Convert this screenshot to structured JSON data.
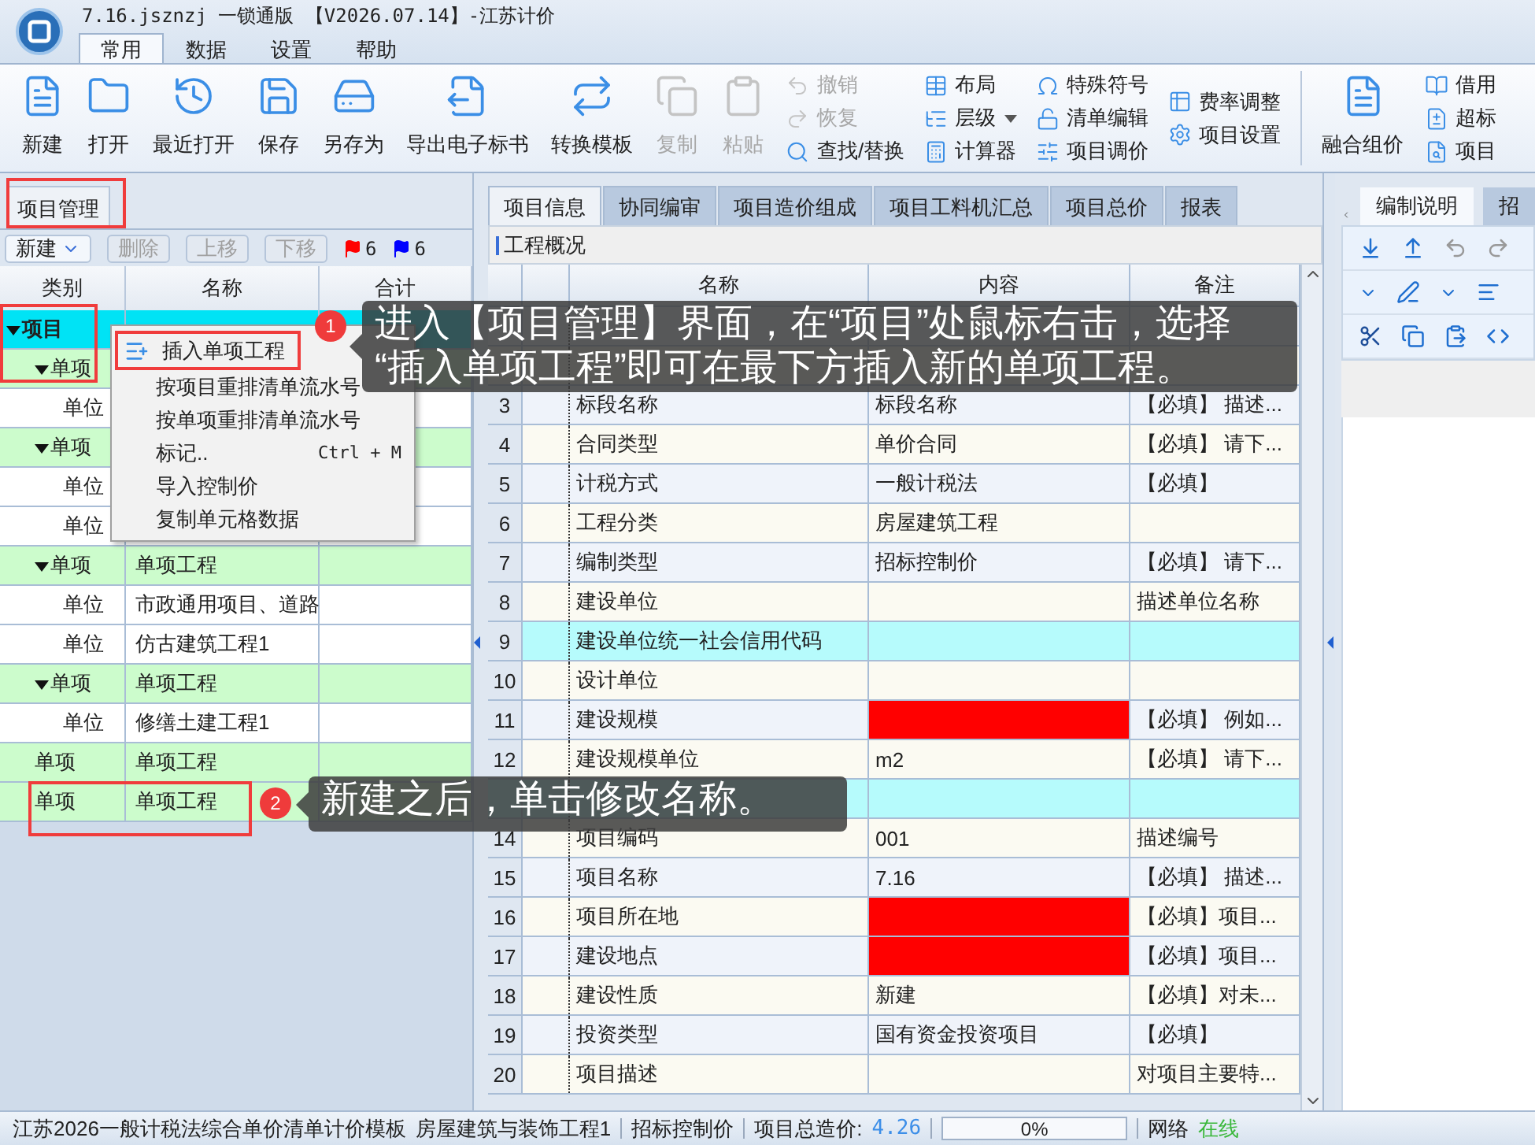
{
  "app": {
    "title": "7.16.jsznzj 一锁通版 【V2026.07.14】-江苏计价"
  },
  "menu_tabs": [
    {
      "label": "常用",
      "selected": true
    },
    {
      "label": "数据",
      "selected": false
    },
    {
      "label": "设置",
      "selected": false
    },
    {
      "label": "帮助",
      "selected": false
    }
  ],
  "ribbon": {
    "large_buttons": [
      {
        "label": "新建",
        "disabled": false
      },
      {
        "label": "打开",
        "disabled": false
      },
      {
        "label": "最近打开",
        "disabled": false
      },
      {
        "label": "保存",
        "disabled": false
      },
      {
        "label": "另存为",
        "disabled": false
      },
      {
        "label": "导出电子标书",
        "disabled": false
      },
      {
        "label": "转换模板",
        "disabled": false
      },
      {
        "label": "复制",
        "disabled": true
      },
      {
        "label": "粘贴",
        "disabled": true
      }
    ],
    "small_columns": [
      [
        {
          "label": "撤销",
          "disabled": true
        },
        {
          "label": "恢复",
          "disabled": true
        },
        {
          "label": "查找/替换",
          "disabled": false
        }
      ],
      [
        {
          "label": "布局",
          "disabled": false
        },
        {
          "label": "层级",
          "disabled": false,
          "dropdown": true
        },
        {
          "label": "计算器",
          "disabled": false
        }
      ],
      [
        {
          "label": "特殊符号",
          "disabled": false
        },
        {
          "label": "清单编辑",
          "disabled": false
        },
        {
          "label": "项目调价",
          "disabled": false
        }
      ],
      [
        {
          "label": "费率调整",
          "disabled": false
        },
        {
          "label": "项目设置",
          "disabled": false
        }
      ]
    ],
    "merge_button": "融合组价",
    "edge_column": [
      "借用",
      "超标",
      "项目"
    ]
  },
  "left_panel": {
    "title": "项目管理",
    "toolbar": [
      {
        "label": "新建",
        "disabled": false,
        "dropdown": true
      },
      {
        "label": "删除",
        "disabled": true
      },
      {
        "label": "上移",
        "disabled": true
      },
      {
        "label": "下移",
        "disabled": true
      }
    ],
    "flags": [
      {
        "count": "6",
        "color": "#ff0000"
      },
      {
        "count": "6",
        "color": "#0000ff"
      }
    ],
    "columns": [
      "类别",
      "名称",
      "合计"
    ],
    "tree": [
      {
        "category": "项目",
        "selected": true,
        "expanded": true,
        "children": [
          {
            "category": "单项",
            "selected": false,
            "expanded": true,
            "children": [
              {
                "category": "单位",
                "selected": false
              }
            ]
          },
          {
            "category": "单项",
            "selected": false,
            "expanded": true,
            "children": [
              {
                "category": "单位",
                "selected": false
              },
              {
                "category": "单位",
                "selected": false
              }
            ]
          },
          {
            "category": "单项",
            "name": "单项工程",
            "selected": false,
            "expanded": true,
            "children": [
              {
                "category": "单位",
                "name": "市政通用项目、道路",
                "selected": false
              },
              {
                "category": "单位",
                "name": "仿古建筑工程1",
                "selected": false
              }
            ]
          },
          {
            "category": "单项",
            "name": "单项工程",
            "selected": false,
            "expanded": true,
            "children": [
              {
                "category": "单位",
                "name": "修缮土建工程1",
                "selected": false
              }
            ]
          },
          {
            "category": "单项",
            "name": "单项工程",
            "selected": false
          },
          {
            "category": "单项",
            "name": "单项工程",
            "selected": false
          }
        ]
      }
    ]
  },
  "context_menu": {
    "items": [
      {
        "label": "插入单项工程",
        "selected": true
      },
      {
        "label": "按项目重排清单流水号",
        "selected": false
      },
      {
        "label": "按单项重排清单流水号",
        "selected": false
      },
      {
        "label": "标记..",
        "shortcut": "Ctrl + M",
        "selected": false
      },
      {
        "label": "导入控制价",
        "selected": false
      },
      {
        "label": "复制单元格数据",
        "selected": false
      }
    ]
  },
  "center": {
    "tabs": [
      {
        "label": "项目信息",
        "selected": true
      },
      {
        "label": "协同编审",
        "selected": false
      },
      {
        "label": "项目造价组成",
        "selected": false
      },
      {
        "label": "项目工料机汇总",
        "selected": false
      },
      {
        "label": "项目总价",
        "selected": false
      },
      {
        "label": "报表",
        "selected": false
      }
    ],
    "section": "工程概况",
    "columns": [
      "名称",
      "内容",
      "备注"
    ],
    "rows": [
      {},
      {},
      {
        "number": "3",
        "name": "标段名称",
        "content": "标段名称",
        "remark": "【必填】 描述...",
        "highlighted": false,
        "alert": false
      },
      {
        "number": "4",
        "name": "合同类型",
        "content": "单价合同",
        "remark": "【必填】 请下...",
        "highlighted": false,
        "alert": false
      },
      {
        "number": "5",
        "name": "计税方式",
        "content": "一般计税法",
        "remark": "【必填】",
        "highlighted": false,
        "alert": false
      },
      {
        "number": "6",
        "name": "工程分类",
        "content": "房屋建筑工程",
        "highlighted": false,
        "alert": false
      },
      {
        "number": "7",
        "name": "编制类型",
        "content": "招标控制价",
        "remark": "【必填】 请下...",
        "highlighted": false,
        "alert": false
      },
      {
        "number": "8",
        "name": "建设单位",
        "remark": "描述单位名称",
        "highlighted": false,
        "alert": false
      },
      {
        "number": "9",
        "name": "建设单位统一社会信用代码",
        "highlighted": true,
        "alert": false
      },
      {
        "number": "10",
        "name": "设计单位",
        "highlighted": false,
        "alert": false
      },
      {
        "number": "11",
        "name": "建设规模",
        "remark": "【必填】 例如...",
        "highlighted": false,
        "alert": true
      },
      {
        "number": "12",
        "name": "建设规模单位",
        "content": "m2",
        "remark": "【必填】 请下...",
        "highlighted": false,
        "alert": false
      },
      {
        "highlighted": true,
        "alert": false
      },
      {
        "number": "14",
        "name": "项目编码",
        "content": "001",
        "remark": "描述编号",
        "highlighted": false,
        "alert": false
      },
      {
        "number": "15",
        "name": "项目名称",
        "content": "7.16",
        "remark": "【必填】 描述...",
        "highlighted": false,
        "alert": false
      },
      {
        "number": "16",
        "name": "项目所在地",
        "remark": "【必填】项目...",
        "highlighted": false,
        "alert": true
      },
      {
        "number": "17",
        "name": "建设地点",
        "remark": "【必填】项目...",
        "highlighted": false,
        "alert": true
      },
      {
        "number": "18",
        "name": "建设性质",
        "content": "新建",
        "remark": "【必填】对未...",
        "highlighted": false,
        "alert": false
      },
      {
        "number": "19",
        "name": "投资类型",
        "content": "国有资金投资项目",
        "remark": "【必填】",
        "highlighted": false,
        "alert": false
      },
      {
        "number": "20",
        "name": "项目描述",
        "remark": "对项目主要特...",
        "highlighted": false,
        "alert": false
      }
    ]
  },
  "right_panel": {
    "tabs": [
      {
        "label": "编制说明",
        "selected": true
      },
      {
        "label": "招",
        "selected": false
      }
    ]
  },
  "callouts": [
    {
      "number": "1",
      "lines": [
        "进入【项目管理】界面，在“项目”处鼠标右击，选择",
        "“插入单项工程”即可在最下方插入新的单项工程。"
      ]
    },
    {
      "number": "2",
      "lines": [
        "新建之后，单击修改名称。"
      ]
    }
  ],
  "status_bar": {
    "template": "江苏2026一般计税法综合单价清单计价模板",
    "project": "房屋建筑与装饰工程1",
    "price_type": "招标控制价",
    "total_label": "项目总造价:",
    "total_value": "4.26",
    "progress": {
      "level": 0,
      "reading": "0%"
    },
    "network_label": "网络",
    "network_state": "在线"
  }
}
